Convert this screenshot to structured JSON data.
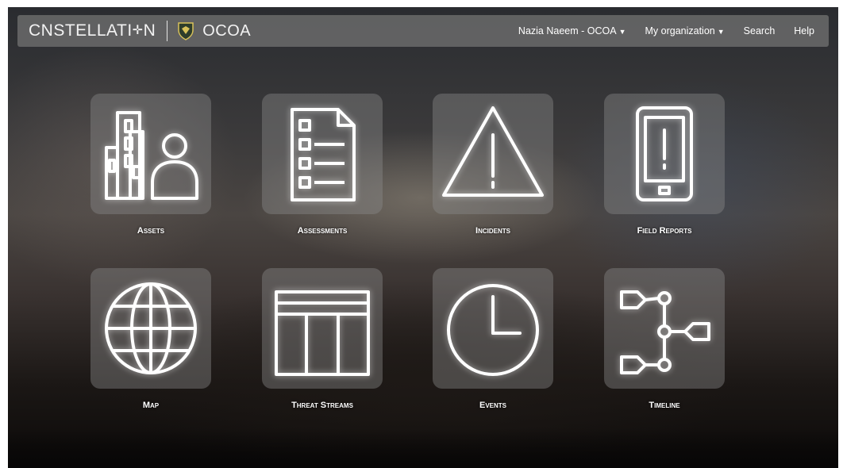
{
  "header": {
    "brand_left": "C",
    "brand_rest": "NSTELLATI",
    "brand_end": "N",
    "org_name": "OCOA",
    "user_menu": "Nazia Naeem - OCOA",
    "org_menu": "My organization",
    "search": "Search",
    "help": "Help",
    "caret": "▼"
  },
  "tiles": [
    {
      "label": "Assets"
    },
    {
      "label": "Assessments"
    },
    {
      "label": "Incidents"
    },
    {
      "label": "Field Reports"
    },
    {
      "label": "Map"
    },
    {
      "label": "Threat Streams"
    },
    {
      "label": "Events"
    },
    {
      "label": "Timeline"
    }
  ],
  "colors": {
    "navbar": "#707070",
    "tile": "#8a8a8a",
    "icon_stroke": "#ffffff"
  }
}
